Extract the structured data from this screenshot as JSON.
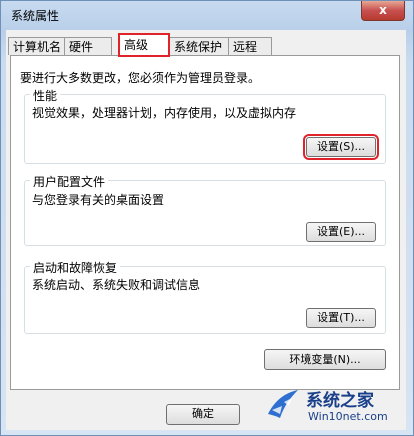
{
  "window": {
    "title": "系统属性",
    "close_label": "x"
  },
  "tabs": [
    {
      "label": "计算机名"
    },
    {
      "label": "硬件"
    },
    {
      "label": "高级"
    },
    {
      "label": "系统保护"
    },
    {
      "label": "远程"
    }
  ],
  "intro": "要进行大多数更改，您必须作为管理员登录。",
  "performance": {
    "title": "性能",
    "description": "视觉效果，处理器计划，内存使用，以及虚拟内存",
    "button": "设置(S)..."
  },
  "user_profiles": {
    "title": "用户配置文件",
    "description": "与您登录有关的桌面设置",
    "button": "设置(E)..."
  },
  "startup_recovery": {
    "title": "启动和故障恢复",
    "description": "系统启动、系统失败和调试信息",
    "button": "设置(T)..."
  },
  "env_button": "环境变量(N)...",
  "ok_button": "确定",
  "watermark": {
    "name": "系统之家",
    "url": "Win10net.com"
  }
}
